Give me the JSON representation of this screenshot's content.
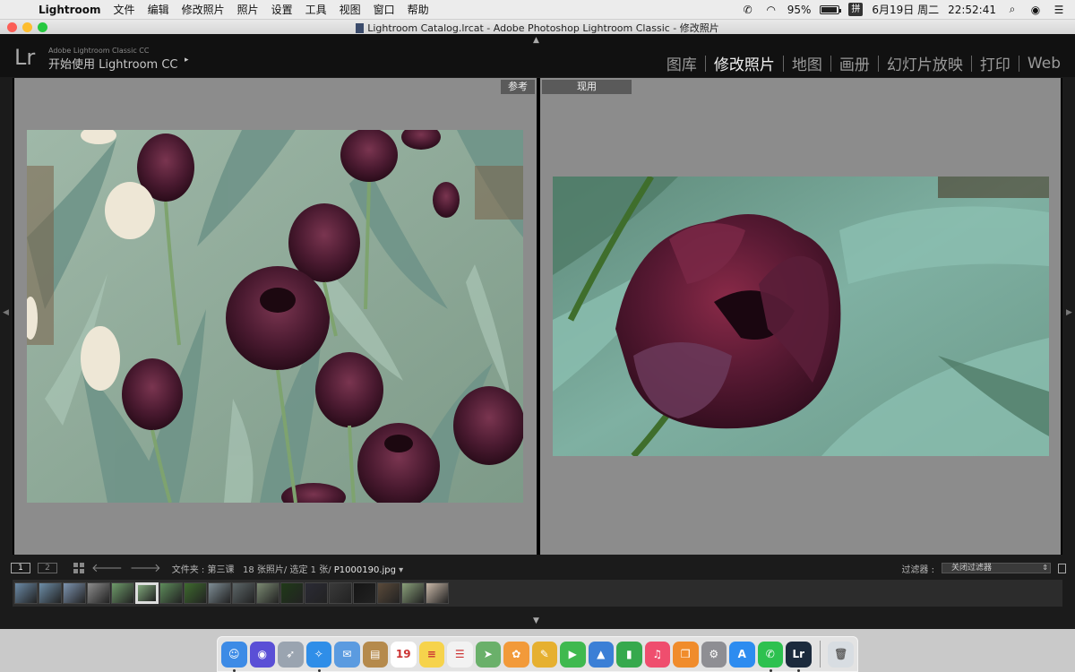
{
  "menubar": {
    "app": "Lightroom",
    "items": [
      "文件",
      "编辑",
      "修改照片",
      "照片",
      "设置",
      "工具",
      "视图",
      "窗口",
      "帮助"
    ],
    "battery": "95%",
    "battery_level": 0.95,
    "ime": "拼",
    "date": "6月19日 周二",
    "time": "22:52:41"
  },
  "window": {
    "title": "Lightroom Catalog.lrcat - Adobe Photoshop Lightroom Classic - 修改照片"
  },
  "lr_header": {
    "logo": "Lr",
    "product": "Adobe Lightroom Classic CC",
    "getting_started": "开始使用 Lightroom CC",
    "arrow": "▸",
    "modules": [
      {
        "label": "图库",
        "active": false
      },
      {
        "label": "修改照片",
        "active": true
      },
      {
        "label": "地图",
        "active": false
      },
      {
        "label": "画册",
        "active": false
      },
      {
        "label": "幻灯片放映",
        "active": false
      },
      {
        "label": "打印",
        "active": false
      },
      {
        "label": "Web",
        "active": false
      }
    ]
  },
  "compare": {
    "reference_label": "参考",
    "current_label": "现用"
  },
  "filmstrip_bar": {
    "monitor1": "1",
    "monitor2": "2",
    "folder": "文件夹 : 第三课",
    "count": "18 张照片/ 选定 1 张/",
    "current_file": "P1000190.jpg",
    "file_arrow": "▾",
    "filter_label": "过滤器 :",
    "filter_value": "关闭过滤器"
  },
  "filmstrip": {
    "thumbs": [
      "#6b8aa6",
      "#6d8ea8",
      "#7d94b0",
      "#8c8c8c",
      "#6e9b6a",
      "#7fa67a",
      "#5d8c5a",
      "#3e6b2e",
      "#7e8d95",
      "#5c6668",
      "#7b8a72",
      "#1f3a18",
      "#2b2b35",
      "#3a3a3a",
      "#151515",
      "#5a4a3a",
      "#8aa07a",
      "#c9b8a8"
    ],
    "selected_index": 5
  },
  "dock": {
    "apps": [
      {
        "name": "finder-icon",
        "color": "#3d8be6",
        "glyph": "☺"
      },
      {
        "name": "siri-icon",
        "color": "#5a4fd6",
        "glyph": "◉"
      },
      {
        "name": "launchpad-icon",
        "color": "#9aa4b0",
        "glyph": "➶"
      },
      {
        "name": "safari-icon",
        "color": "#2f8ee8",
        "glyph": "✧"
      },
      {
        "name": "mail-icon",
        "color": "#5b9be0",
        "glyph": "✉"
      },
      {
        "name": "notebook-icon",
        "color": "#b58a4c",
        "glyph": "▤"
      },
      {
        "name": "calendar-icon",
        "color": "#ffffff",
        "glyph": "19"
      },
      {
        "name": "notes-icon",
        "color": "#f6d34c",
        "glyph": "≡"
      },
      {
        "name": "reminders-icon",
        "color": "#f2f2f2",
        "glyph": "☰"
      },
      {
        "name": "maps-icon",
        "color": "#6ab06a",
        "glyph": "➤"
      },
      {
        "name": "photos-icon",
        "color": "#f29a3a",
        "glyph": "✿"
      },
      {
        "name": "sketch-icon",
        "color": "#e6b030",
        "glyph": "✎"
      },
      {
        "name": "facetime-icon",
        "color": "#3fb94f",
        "glyph": "▶"
      },
      {
        "name": "keynote-icon",
        "color": "#3b7fd6",
        "glyph": "▲"
      },
      {
        "name": "numbers-icon",
        "color": "#36a94d",
        "glyph": "▮"
      },
      {
        "name": "music-icon",
        "color": "#ef4e6e",
        "glyph": "♫"
      },
      {
        "name": "books-icon",
        "color": "#f08c2c",
        "glyph": "❒"
      },
      {
        "name": "system-preferences-icon",
        "color": "#8e8e93",
        "glyph": "⚙"
      },
      {
        "name": "app-store-icon",
        "color": "#2d8cf0",
        "glyph": "A"
      },
      {
        "name": "wechat-icon",
        "color": "#2dc14f",
        "glyph": "✆"
      },
      {
        "name": "lightroom-icon",
        "color": "#1c2b3d",
        "glyph": "Lr"
      }
    ],
    "trash": {
      "name": "trash-icon",
      "color": "#d8dde2",
      "glyph": "🗑"
    }
  }
}
